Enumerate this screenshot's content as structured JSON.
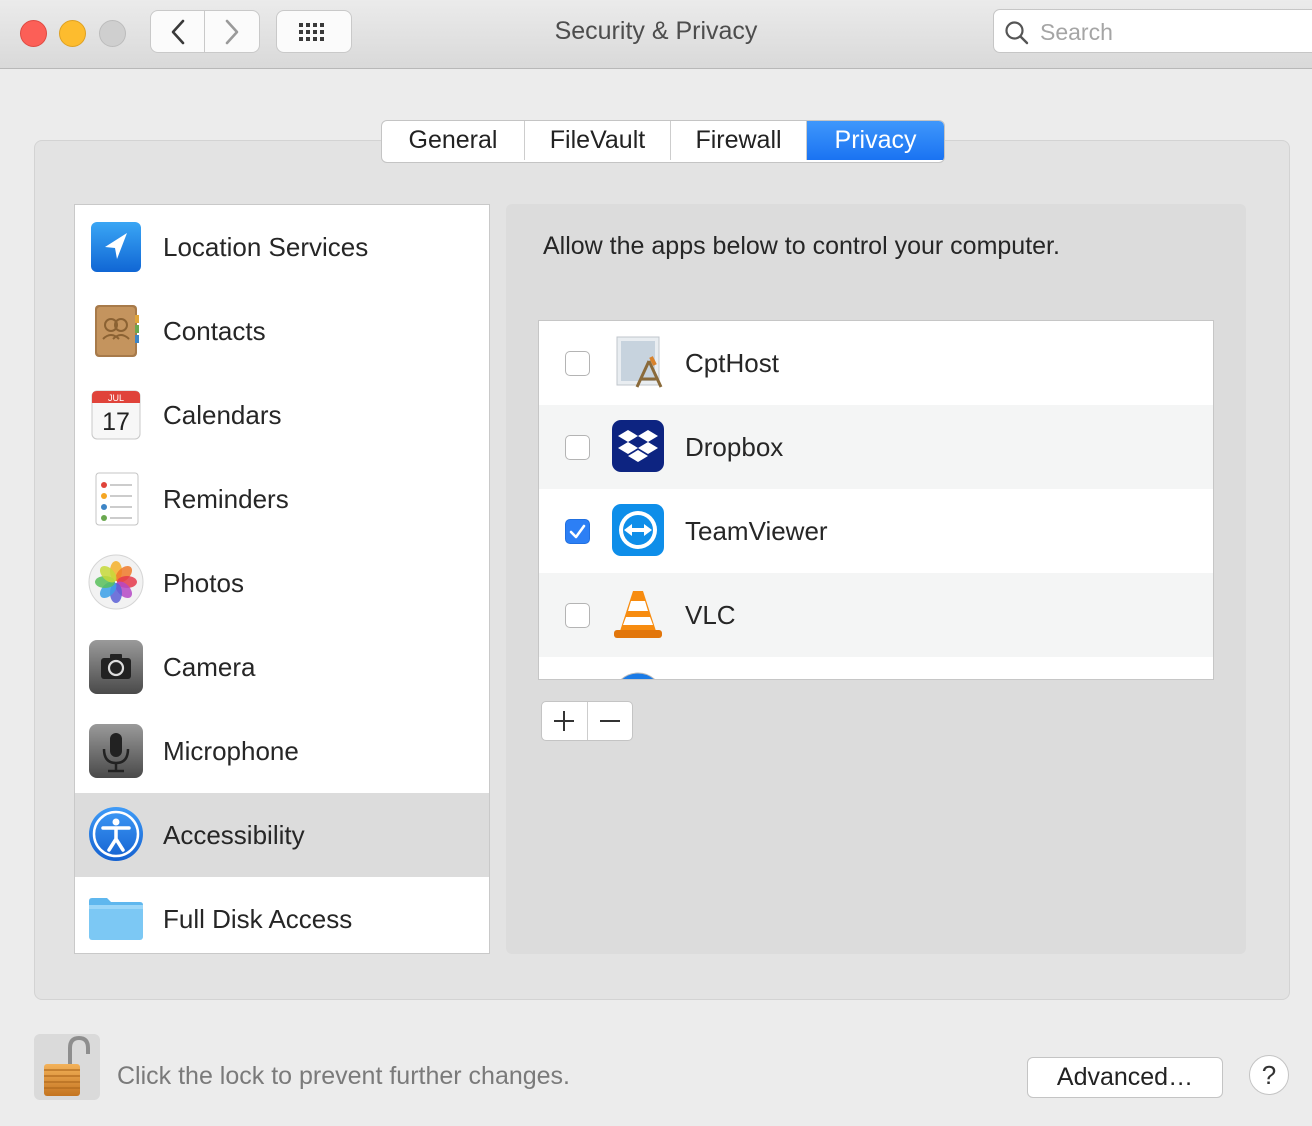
{
  "window": {
    "title": "Security & Privacy"
  },
  "search": {
    "placeholder": "Search"
  },
  "tabs": [
    {
      "label": "General",
      "active": false
    },
    {
      "label": "FileVault",
      "active": false
    },
    {
      "label": "Firewall",
      "active": false
    },
    {
      "label": "Privacy",
      "active": true
    }
  ],
  "sidebar": {
    "items": [
      {
        "label": "Location Services",
        "icon": "location-arrow-icon"
      },
      {
        "label": "Contacts",
        "icon": "contacts-book-icon"
      },
      {
        "label": "Calendars",
        "icon": "calendar-icon",
        "month": "JUL",
        "day": "17"
      },
      {
        "label": "Reminders",
        "icon": "reminders-list-icon"
      },
      {
        "label": "Photos",
        "icon": "photos-flower-icon"
      },
      {
        "label": "Camera",
        "icon": "camera-icon"
      },
      {
        "label": "Microphone",
        "icon": "microphone-icon"
      },
      {
        "label": "Accessibility",
        "icon": "accessibility-icon",
        "selected": true
      },
      {
        "label": "Full Disk Access",
        "icon": "folder-icon"
      }
    ]
  },
  "main": {
    "description": "Allow the apps below to control your computer.",
    "apps": [
      {
        "name": "CptHost",
        "checked": false,
        "icon": "cpthost-app-icon"
      },
      {
        "name": "Dropbox",
        "checked": false,
        "icon": "dropbox-icon"
      },
      {
        "name": "TeamViewer",
        "checked": true,
        "icon": "teamviewer-icon"
      },
      {
        "name": "VLC",
        "checked": false,
        "icon": "vlc-cone-icon"
      }
    ],
    "add_symbol": "+",
    "remove_symbol": "−"
  },
  "footer": {
    "lock_text": "Click the lock to prevent further changes.",
    "advanced_label": "Advanced…",
    "help_label": "?"
  },
  "colors": {
    "accent": "#1a73f2",
    "selected_row": "#dcdcdc"
  }
}
